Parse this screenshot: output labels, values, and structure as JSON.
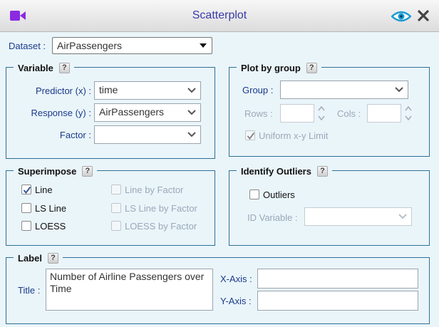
{
  "window": {
    "title": "Scatterplot"
  },
  "dataset": {
    "label": "Dataset :",
    "value": "AirPassengers"
  },
  "variable": {
    "title": "Variable",
    "help": "?",
    "predictor_label": "Predictor (x) :",
    "predictor_value": "time",
    "response_label": "Response (y) :",
    "response_value": "AirPassengers",
    "factor_label": "Factor :",
    "factor_value": ""
  },
  "plot_by_group": {
    "title": "Plot by group",
    "help": "?",
    "group_label": "Group :",
    "group_value": "",
    "rows_label": "Rows :",
    "rows_value": "",
    "cols_label": "Cols :",
    "cols_value": "",
    "uniform_label": "Uniform x-y Limit",
    "uniform_checked": true
  },
  "superimpose": {
    "title": "Superimpose",
    "help": "?",
    "line": "Line",
    "line_checked": true,
    "ls_line": "LS Line",
    "loess": "LOESS",
    "line_by_factor": "Line by Factor",
    "ls_line_by_factor": "LS Line by Factor",
    "loess_by_factor": "LOESS by Factor"
  },
  "identify_outliers": {
    "title": "Identify Outliers",
    "help": "?",
    "outliers_label": "Outliers",
    "id_variable_label": "ID Variable :",
    "id_variable_value": ""
  },
  "label": {
    "title": "Label",
    "help": "?",
    "title_label": "Title :",
    "title_value": "Number of Airline Passengers over Time",
    "xaxis_label": "X-Axis :",
    "xaxis_value": "",
    "yaxis_label": "Y-Axis :",
    "yaxis_value": ""
  },
  "colors": {
    "accent": "#2f6f95",
    "label_text": "#1a3a8a",
    "disabled_text": "#9aa8b8",
    "cam_icon": "#8a2be2",
    "eye_icon": "#1a9ad0"
  }
}
